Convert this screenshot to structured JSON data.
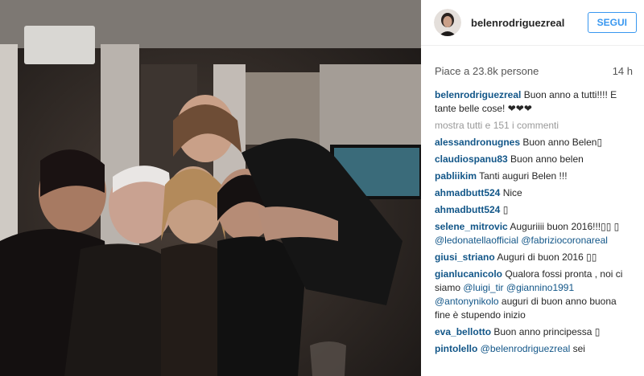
{
  "post": {
    "username": "belenrodriguezreal",
    "follow_label": "SEGUI",
    "likes": "Piace a 23.8k persone",
    "time": "14 h"
  },
  "caption": {
    "user": "belenrodriguezreal",
    "text": "Buon anno a tutti!!!! E tante belle cose! ❤❤❤"
  },
  "more_comments": "mostra tutti e 151 i commenti",
  "comments": [
    {
      "user": "alessandronugnes",
      "text": " Buon anno Belen▯"
    },
    {
      "user": "claudiospanu83",
      "text": " Buon anno belen"
    },
    {
      "user": "pabliikim",
      "text": " Tanti auguri Belen !!!"
    },
    {
      "user": "ahmadbutt524",
      "text": " Nice"
    },
    {
      "user": "ahmadbutt524",
      "text": " ▯"
    },
    {
      "user": "selene_mitrovic",
      "text": " Auguriiii buon 2016!!!▯▯ ▯",
      "m1": "@ledonatellaofficial",
      "m2": "@fabriziocoronareal"
    },
    {
      "user": "giusi_striano",
      "text": " Auguri di buon 2016 ▯▯"
    },
    {
      "user": "gianlucanicolo",
      "text": " Qualora fossi pronta , noi ci siamo ",
      "m1": "@luigi_tir",
      "m2": "@giannino1991",
      "m3": "@antonynikolo",
      "tail": " auguri di buon anno buona fine è stupendo inizio"
    },
    {
      "user": "eva_bellotto",
      "text": " Buon anno principessa ▯"
    },
    {
      "user": "pintolello",
      "text": " ",
      "m1": "@belenrodriguezreal",
      "tail": " sei"
    }
  ]
}
